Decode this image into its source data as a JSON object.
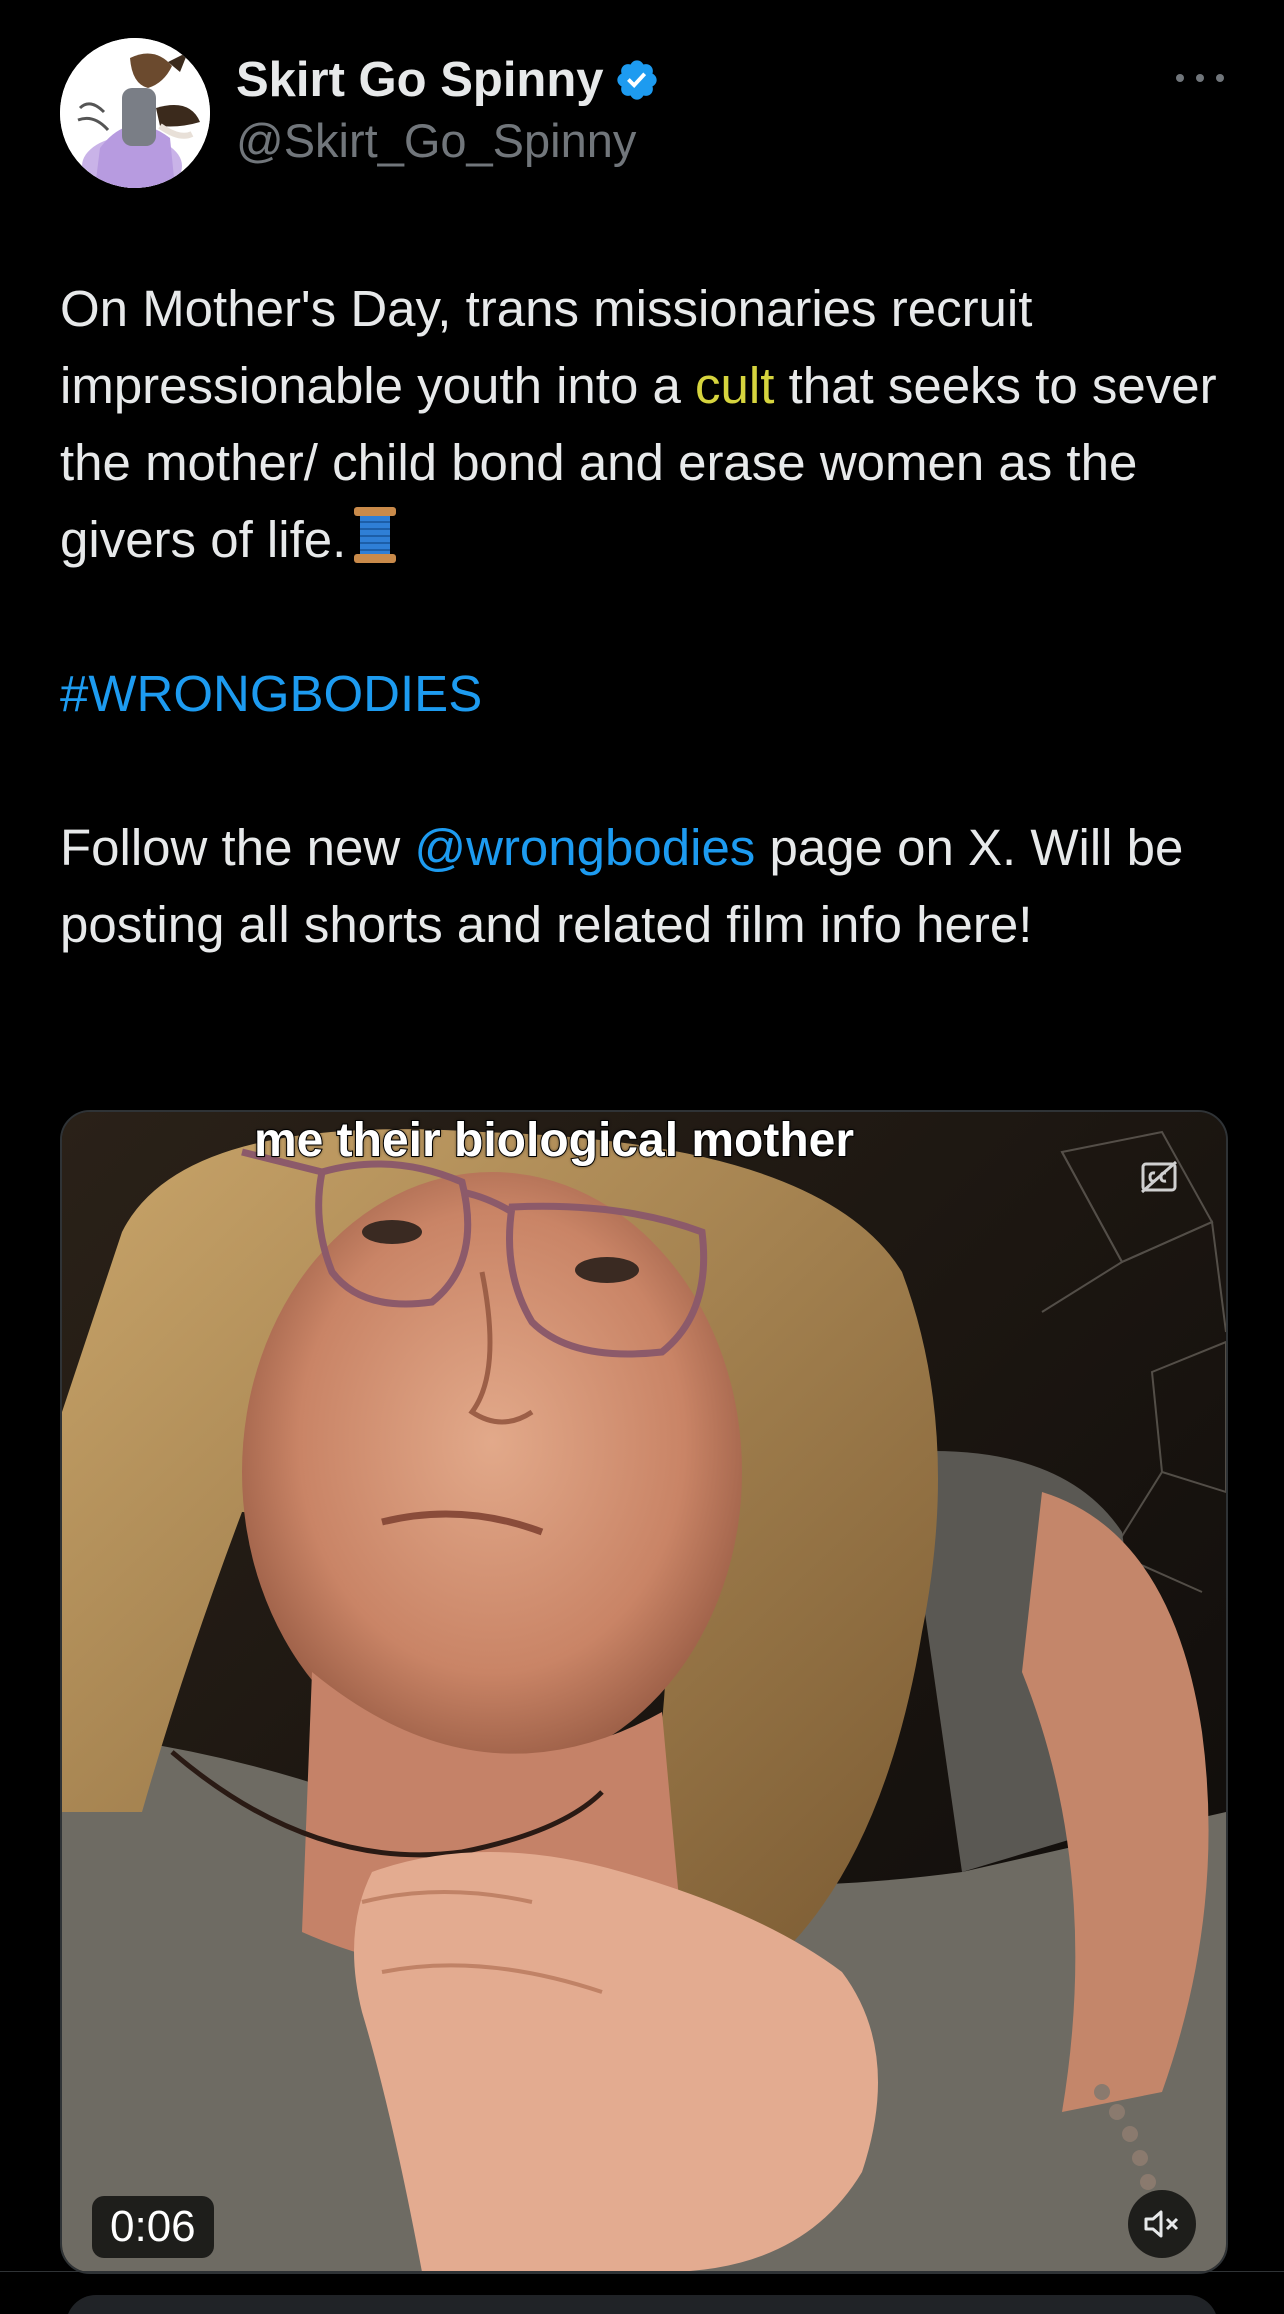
{
  "author": {
    "display_name": "Skirt Go Spinny",
    "handle": "@Skirt_Go_Spinny",
    "verified_icon": "verified-badge-icon",
    "verified_color": "#1d9bf0"
  },
  "tweet": {
    "line1_before": "On Mother's Day, trans missionaries recruit impressionable youth into a ",
    "line1_highlight": "cult",
    "line1_after": " that seeks to sever the mother/ child bond and erase women as the givers of life.",
    "emoji_icon": "spool-of-thread-icon",
    "hashtag": "#WRONGBODIES",
    "follow_before": "Follow the new ",
    "follow_mention": "@wrongbodies",
    "follow_after": " page on X. Will be posting all shorts and related film info here!",
    "highlight_color": "#d6d43e",
    "link_color": "#1d9bf0"
  },
  "video": {
    "caption": "me their biological mother",
    "elapsed": "0:06",
    "cc_icon": "closed-captions-icon",
    "mute_icon": "speaker-muted-icon"
  },
  "more_icon": "more-options-icon"
}
